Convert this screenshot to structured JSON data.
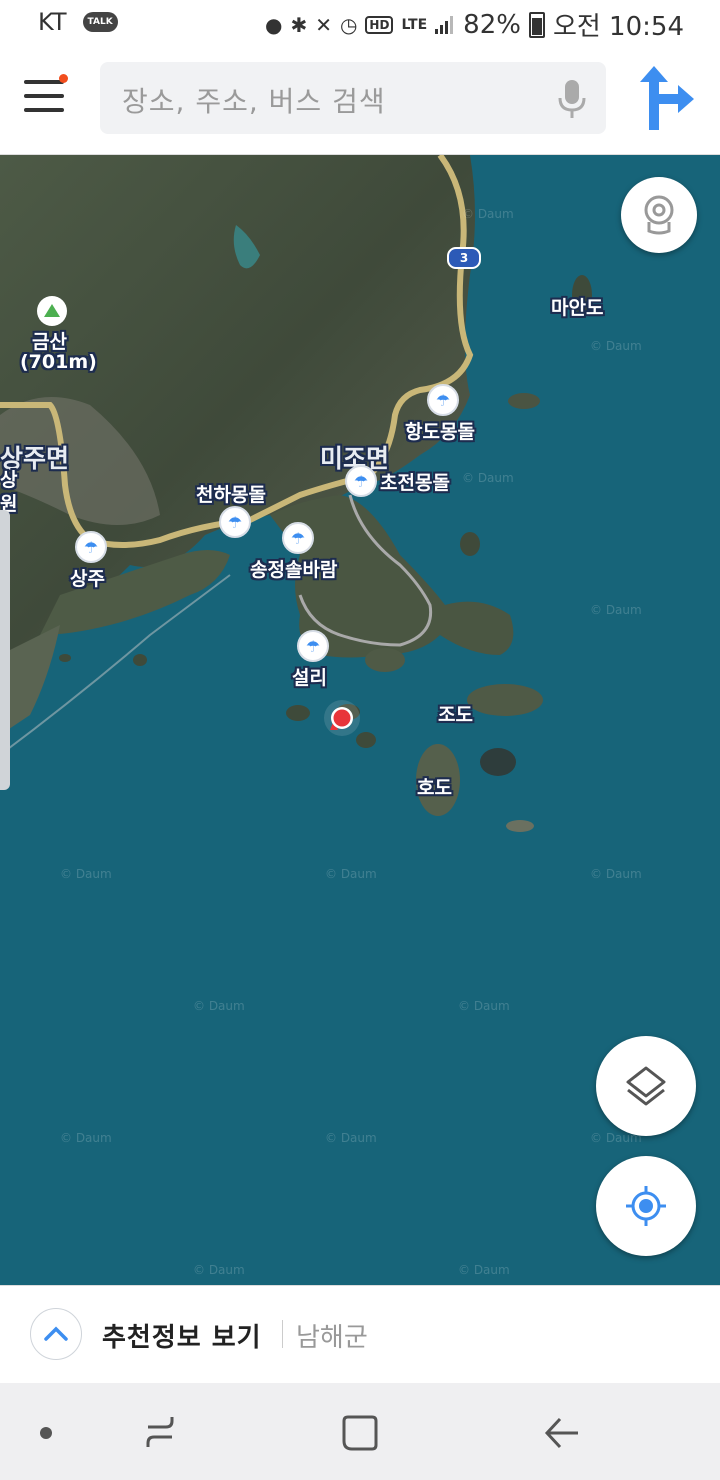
{
  "status_bar": {
    "carrier": "KT",
    "talk_badge": "TALK",
    "lte": "LTE",
    "hd": "HD",
    "battery": "82%",
    "time": "오전 10:54"
  },
  "search": {
    "placeholder": "장소, 주소, 버스 검색"
  },
  "map": {
    "labels": {
      "mountain_name": "금산",
      "mountain_height": "(701m)",
      "town_sangju_myeon": "상주면",
      "town_mijo_myeon": "미조면",
      "sang": "상",
      "won": "원",
      "maan_do": "마안도",
      "hangdo_mongdol": "항도몽돌",
      "chojeon_mongdol": "초전몽돌",
      "cheonha_mongdol": "천하몽돌",
      "songjeong_solbaram": "송정솔바람",
      "sangju": "상주",
      "seolli": "설리",
      "jo_do": "조도",
      "ho_do": "호도"
    },
    "road_number": "3",
    "watermark": "© Daum"
  },
  "bottom_panel": {
    "title": "추천정보 보기",
    "region": "남해군"
  },
  "colors": {
    "sea": "#176479",
    "accent_blue": "#3d8ef0",
    "location_red": "#e8353a",
    "menu_dot": "#f24e1e"
  },
  "icons": {
    "menu": "hamburger-menu-icon",
    "mic": "microphone-icon",
    "route": "directions-icon",
    "street_view": "street-view-icon",
    "layers": "layers-icon",
    "my_location": "my-location-icon",
    "expand": "chevron-up-icon"
  }
}
